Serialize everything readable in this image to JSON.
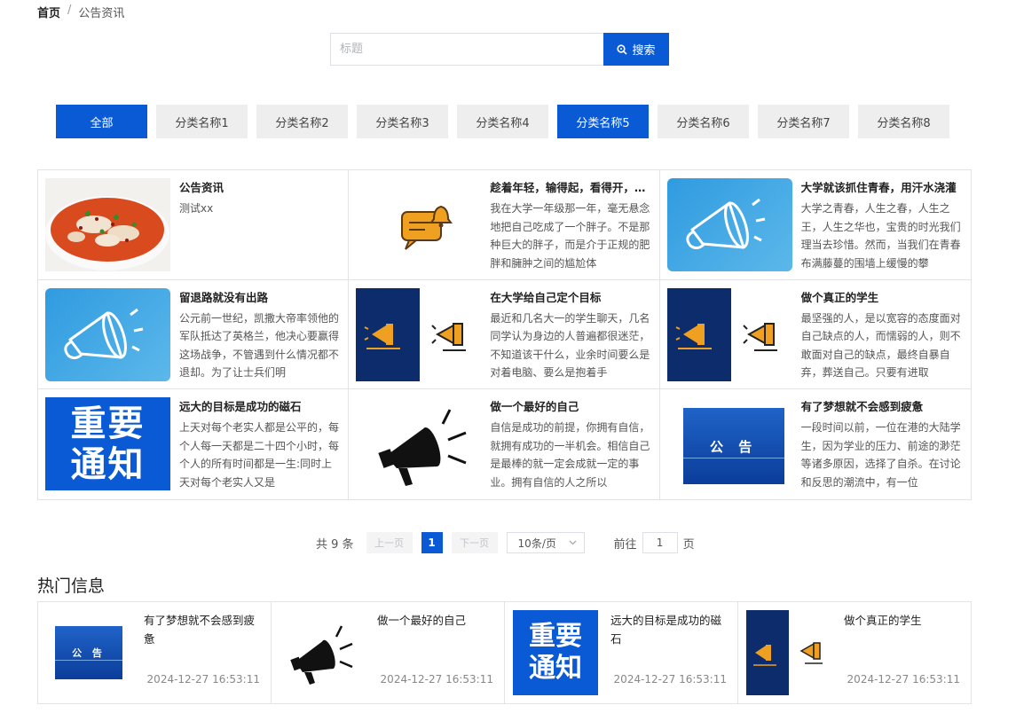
{
  "breadcrumb": {
    "home": "首页",
    "separator": "/",
    "current": "公告资讯"
  },
  "search": {
    "placeholder": "标题",
    "button_label": "搜索"
  },
  "tabs": [
    {
      "label": "全部",
      "active": true
    },
    {
      "label": "分类名称1",
      "active": false
    },
    {
      "label": "分类名称2",
      "active": false
    },
    {
      "label": "分类名称3",
      "active": false
    },
    {
      "label": "分类名称4",
      "active": false
    },
    {
      "label": "分类名称5",
      "active": true
    },
    {
      "label": "分类名称6",
      "active": false
    },
    {
      "label": "分类名称7",
      "active": false
    },
    {
      "label": "分类名称8",
      "active": false
    }
  ],
  "cards": [
    {
      "title": "公告资讯",
      "desc": "测试xx",
      "thumb": "food-photo"
    },
    {
      "title": "趁着年轻，输得起，看得开，爱得起，放得下",
      "desc": "我在大学一年级那一年，毫无悬念地把自己吃成了一个胖子。不是那种巨大的胖子，而是介于正规的肥胖和臃肿之间的尴尬体",
      "thumb": "chat-bell-icon"
    },
    {
      "title": "大学就该抓住青春，用汗水浇灌",
      "desc": "大学之青春，人生之春，人生之王，人生之华也，宝贵的时光我们理当去珍惜。然而，当我们在青春布满藤蔓的围墙上缓慢的攀",
      "thumb": "megaphone-outline-blue"
    },
    {
      "title": "留退路就没有出路",
      "desc": "公元前一世纪，凯撒大帝率领他的军队抵达了英格兰，他决心要赢得这场战争，不管遇到什么情况都不退却。为了让士兵们明",
      "thumb": "megaphone-outline-blue"
    },
    {
      "title": "在大学给自己定个目标",
      "desc": "最近和几名大一的学生聊天，几名同学认为身边的人普遍都很迷茫，不知道该干什么，业余时间要么是对着电脑、要么是抱着手",
      "thumb": "navy-megaphone"
    },
    {
      "title": "做个真正的学生",
      "desc": "最坚强的人，是以宽容的态度面对自己缺点的人，而懦弱的人，则不敢面对自己的缺点，最终自暴自弃，葬送自己。只要有进取",
      "thumb": "navy-megaphone"
    },
    {
      "title": "远大的目标是成功的磁石",
      "desc": "上天对每个老实人都是公平的，每个人每一天都是二十四个小时，每个人的所有时间都是一生:同时上天对每个老实人又是",
      "thumb": "important-notice",
      "thumb_text": "重要通知"
    },
    {
      "title": "做一个最好的自己",
      "desc": "自信是成功的前提，你拥有自信，就拥有成功的一半机会。相信自己是最棒的就一定会成就一定的事业。拥有自信的人之所以",
      "thumb": "black-megaphone"
    },
    {
      "title": "有了梦想就不会感到疲惫",
      "desc": "一段时间以前，一位在港的大陆学生，因为学业的压力、前途的渺茫等诸多原因，选择了自杀。在讨论和反思的潮流中，有一位",
      "thumb": "notice-banner",
      "thumb_text": "公 告"
    }
  ],
  "pagination": {
    "total": "共 9 条",
    "prev": "上一页",
    "current_page": "1",
    "next": "下一页",
    "page_size": "10条/页",
    "goto_label": "前往",
    "goto_value": "1",
    "goto_suffix": "页"
  },
  "hot": {
    "title": "热门信息",
    "items": [
      {
        "title": "有了梦想就不会感到疲惫",
        "time": "2024-12-27 16:53:11",
        "thumb": "notice-banner",
        "thumb_text": "公 告"
      },
      {
        "title": "做一个最好的自己",
        "time": "2024-12-27 16:53:11",
        "thumb": "black-megaphone"
      },
      {
        "title": "远大的目标是成功的磁石",
        "time": "2024-12-27 16:53:11",
        "thumb": "important-notice",
        "thumb_text": "重要通知"
      },
      {
        "title": "做个真正的学生",
        "time": "2024-12-27 16:53:11",
        "thumb": "navy-megaphone"
      }
    ]
  },
  "colors": {
    "accent": "#0a5ad6",
    "tab_bg": "#eeeeee",
    "navy": "#0d2c6b",
    "orange": "#f0a020"
  }
}
